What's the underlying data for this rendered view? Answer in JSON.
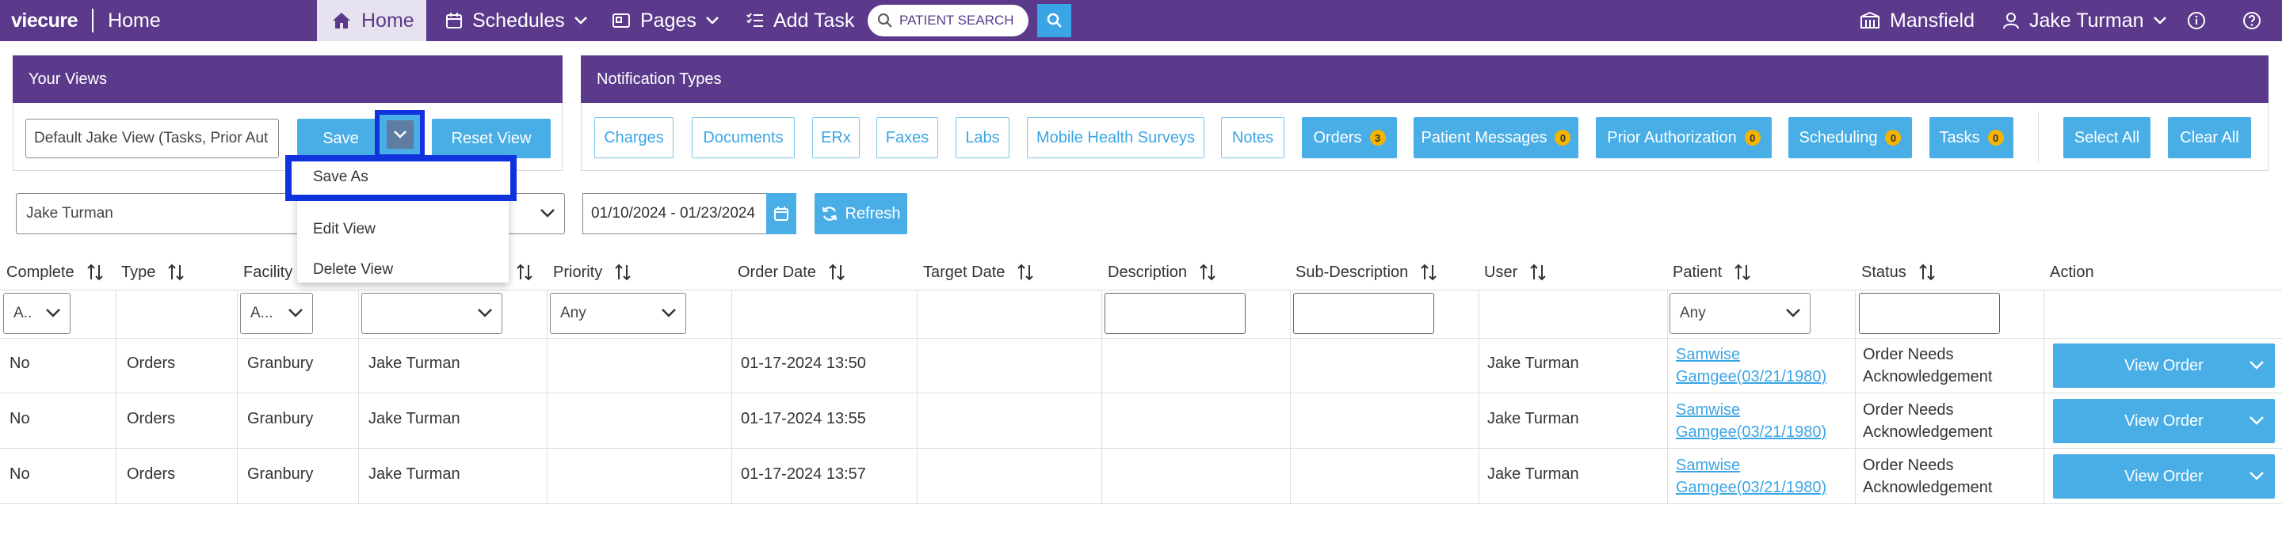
{
  "app": {
    "brand": "viecure",
    "page": "Home"
  },
  "nav": {
    "home": "Home",
    "schedules": "Schedules",
    "pages": "Pages",
    "add_task": "Add Task",
    "search_placeholder": "PATIENT SEARCH",
    "location": "Mansfield",
    "user": "Jake Turman"
  },
  "views_panel": {
    "title": "Your Views",
    "current_view": "Default Jake View (Tasks, Prior Aut",
    "save_label": "Save",
    "reset_label": "Reset View",
    "menu": [
      "Save As",
      "Edit View",
      "Delete View"
    ]
  },
  "notifications_panel": {
    "title": "Notification Types",
    "types": [
      {
        "label": "Charges",
        "active": false,
        "count": null
      },
      {
        "label": "Documents",
        "active": false,
        "count": null
      },
      {
        "label": "ERx",
        "active": false,
        "count": null
      },
      {
        "label": "Faxes",
        "active": false,
        "count": null
      },
      {
        "label": "Labs",
        "active": false,
        "count": null
      },
      {
        "label": "Mobile Health Surveys",
        "active": false,
        "count": null
      },
      {
        "label": "Notes",
        "active": false,
        "count": null
      },
      {
        "label": "Orders",
        "active": true,
        "count": "3"
      },
      {
        "label": "Patient Messages",
        "active": true,
        "count": "0"
      },
      {
        "label": "Prior Authorization",
        "active": true,
        "count": "0"
      },
      {
        "label": "Scheduling",
        "active": true,
        "count": "0"
      },
      {
        "label": "Tasks",
        "active": true,
        "count": "0"
      }
    ],
    "select_all": "Select All",
    "clear_all": "Clear All"
  },
  "filters": {
    "user": "Jake Turman",
    "date_range": "01/10/2024 - 01/23/2024",
    "refresh": "Refresh"
  },
  "table": {
    "headers": {
      "complete": "Complete",
      "type": "Type",
      "facility": "Facility",
      "priority": "Priority",
      "order_date": "Order Date",
      "target_date": "Target Date",
      "description": "Description",
      "sub_description": "Sub-Description",
      "user": "User",
      "patient": "Patient",
      "status": "Status",
      "action": "Action"
    },
    "filter_values": {
      "complete": "A..",
      "facility": "A...",
      "priority": "Any",
      "patient": "Any"
    },
    "rows": [
      {
        "complete": "No",
        "type": "Orders",
        "facility": "Granbury",
        "assignee": "Jake Turman",
        "order_date": "01-17-2024 13:50",
        "user": "Jake Turman",
        "patient_l1": "Samwise",
        "patient_l2": "Gamgee(03/21/1980)",
        "status_l1": "Order Needs",
        "status_l2": "Acknowledgement",
        "action": "View Order"
      },
      {
        "complete": "No",
        "type": "Orders",
        "facility": "Granbury",
        "assignee": "Jake Turman",
        "order_date": "01-17-2024 13:55",
        "user": "Jake Turman",
        "patient_l1": "Samwise",
        "patient_l2": "Gamgee(03/21/1980)",
        "status_l1": "Order Needs",
        "status_l2": "Acknowledgement",
        "action": "View Order"
      },
      {
        "complete": "No",
        "type": "Orders",
        "facility": "Granbury",
        "assignee": "Jake Turman",
        "order_date": "01-17-2024 13:57",
        "user": "Jake Turman",
        "patient_l1": "Samwise",
        "patient_l2": "Gamgee(03/21/1980)",
        "status_l1": "Order Needs",
        "status_l2": "Acknowledgement",
        "action": "View Order"
      }
    ]
  },
  "colors": {
    "nav_purple": "#5b3a8c",
    "accent_blue": "#49aee6",
    "highlight_blue": "#1133dd",
    "badge_yellow": "#f4b400"
  }
}
